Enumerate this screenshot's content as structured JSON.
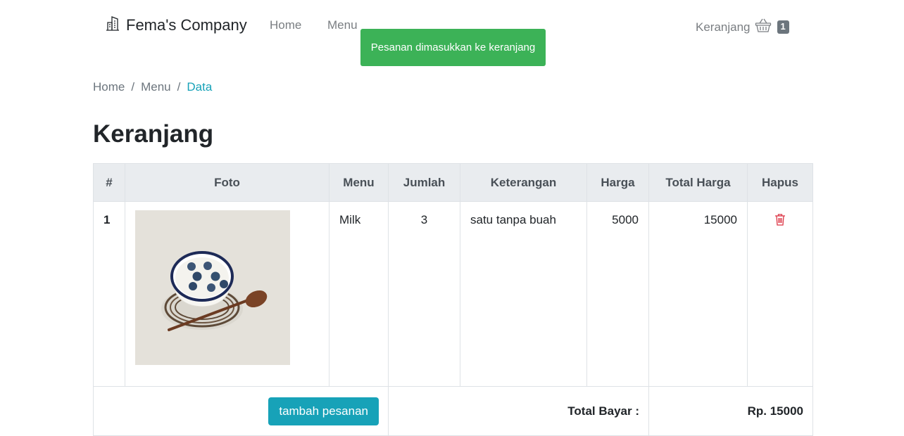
{
  "nav": {
    "brand": "Fema's Company",
    "links": [
      "Home",
      "Menu"
    ],
    "cart_label": "Keranjang",
    "cart_count": "1"
  },
  "toast": {
    "message": "Pesanan dimasukkan ke keranjang",
    "color": "#3cb257"
  },
  "breadcrumb": [
    "Home",
    "Menu",
    "Data"
  ],
  "page_title": "Keranjang",
  "table": {
    "headers": [
      "#",
      "Foto",
      "Menu",
      "Jumlah",
      "Keterangan",
      "Harga",
      "Total Harga",
      "Hapus"
    ],
    "rows": [
      {
        "no": "1",
        "photo": "bowl-of-yogurt-with-blueberries-and-wooden-spoon",
        "menu": "Milk",
        "jumlah": "3",
        "keterangan": "satu tanpa buah",
        "harga": "5000",
        "total": "15000",
        "delete_icon": "trash-icon"
      }
    ],
    "add_button": "tambah pesanan",
    "total_label": "Total Bayar :",
    "total_value": "Rp. 15000"
  },
  "colors": {
    "accent": "#17a2b8",
    "delete": "#dc3545",
    "header_bg": "#e9ecef"
  }
}
